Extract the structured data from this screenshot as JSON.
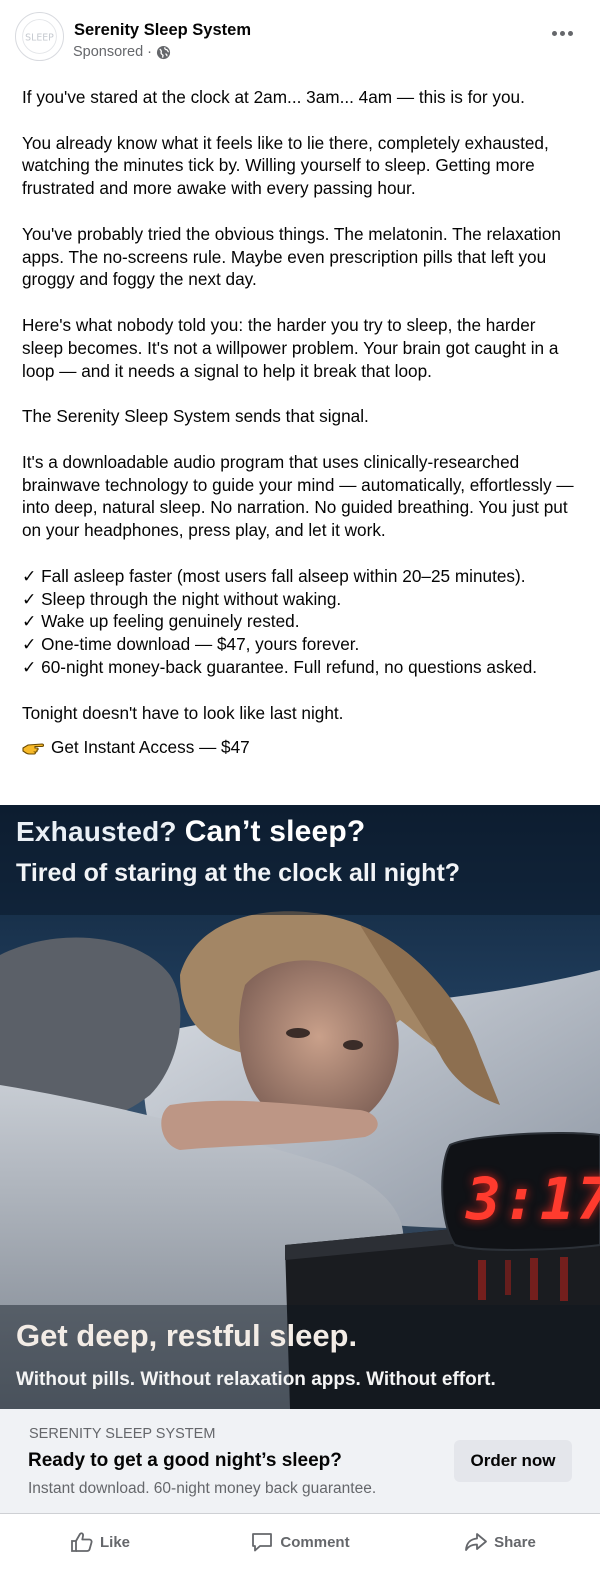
{
  "post": {
    "page_name": "Serenity Sleep System",
    "sponsored_label": "Sponsored",
    "separator": "·",
    "avatar_logo_text": "SLEEP",
    "privacy_icon": "globe-icon",
    "more_icon": "more-options-icon"
  },
  "body": {
    "p1": "If you've stared at the clock at 2am... 3am... 4am — this is for you.",
    "p2": "You already know what it feels like to lie there, completely exhausted, watching the minutes tick by. Willing yourself to sleep. Getting more frustrated and more awake with every passing hour.",
    "p3": "You've probably tried the obvious things. The melatonin. The relaxation apps. The no-screens rule. Maybe even prescription pills that left you groggy and foggy the next day.",
    "p4": "Here's what nobody told you: the harder you try to sleep, the harder sleep becomes. It's not a willpower problem. Your brain got caught in a loop — and it needs a signal to help it break that loop.",
    "p5": "The Serenity Sleep System sends that signal.",
    "p6": "It's a downloadable audio program that uses clinically-researched brainwave technology to guide your mind — automatically, effortlessly — into deep, natural sleep. No narration. No guided breathing. You just put on your headphones, press play, and let it work.",
    "checklist": [
      "✓ Fall asleep faster (most users fall alseep within 20–25 minutes).",
      "✓ Sleep through the night without waking.",
      "✓ Wake up feeling genuinely rested.",
      "✓ One-time download — $47, yours forever.",
      "✓ 60-night money-back guarantee. Full refund, no questions asked."
    ],
    "p7": "Tonight doesn't have to look like last night.",
    "cta_icon": "pointing-hand-icon",
    "cta_text": "Get Instant Access — $47"
  },
  "image": {
    "headline_part1": "Exhausted?",
    "headline_part2": "Can’t sleep?",
    "subheadline": "Tired of staring at the clock all night?",
    "clock_time": "3:17",
    "footer_headline": "Get deep, restful sleep.",
    "footer_sub": "Without pills. Without relaxation apps. Without effort."
  },
  "link": {
    "domain": "SERENITY SLEEP SYSTEM",
    "title": "Ready to get a good night’s sleep?",
    "description": "Instant download. 60-night money back guarantee.",
    "button_label": "Order now"
  },
  "actions": {
    "like_label": "Like",
    "comment_label": "Comment",
    "share_label": "Share",
    "like_icon": "thumbs-up-icon",
    "comment_icon": "comment-icon",
    "share_icon": "share-icon"
  },
  "colors": {
    "text_primary": "#050505",
    "text_secondary": "#65676b",
    "link_bar_bg": "#f0f2f5",
    "button_bg": "#e4e6eb",
    "clock_red": "#ff3b2e"
  }
}
